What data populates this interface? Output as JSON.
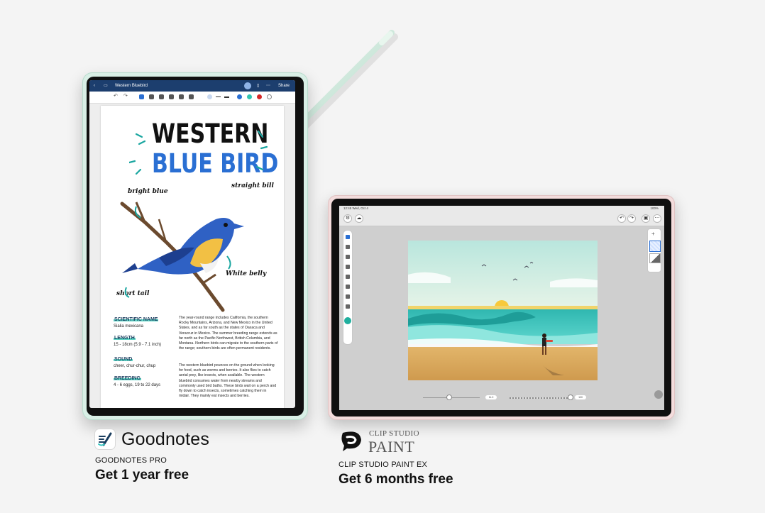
{
  "goodnotes": {
    "app_name": "Goodnotes",
    "product": "GOODNOTES PRO",
    "offer": "Get 1 year free",
    "document_title": "Western Bluebird",
    "share_label": "Share",
    "page": {
      "heading_line1": "WESTERN",
      "heading_line2": "BLUE BIRD",
      "annotations": {
        "bright_blue": "bright blue",
        "straight_bill": "straight bill",
        "white_belly": "White belly",
        "short_tail": "short tail"
      },
      "fields": [
        {
          "label": "SCIENTIFIC NAME",
          "value": "Sialia mexicana"
        },
        {
          "label": "LENGTH",
          "value": "15 - 18cm (5.9 - 7.1 inch)"
        },
        {
          "label": "SOUND",
          "value": "cheer, chur-chur, chup"
        },
        {
          "label": "BREEDING",
          "value": "4 - 6 eggs, 19 to 22 days"
        }
      ],
      "paragraph1": "The year-round range includes California, the southern Rocky Mountains, Arizona, and New Mexico in the United States, and as far south as the states of Oaxaca and Veracruz in Mexico. The summer breeding range extends as far north as the Pacific Northwest, British Columbia, and Montana. Northern birds can migrate to the southern parts of the range; southern birds are often permanent residents.",
      "paragraph2": "The western bluebird pounces on the ground when looking for food, such as worms and berries. It also flies to catch aerial prey, like insects, when available. The western bluebird consumes water from nearby streams and commonly used bird baths. These birds wait on a perch and fly down to catch insects, sometimes catching them in midair. They mainly eat insects and berries."
    },
    "colors": {
      "accent_blue": "#2a6fd3",
      "highlight_teal": "#5fd3c4",
      "topbar": "#1c3e6e"
    }
  },
  "clipstudio": {
    "brand_line1": "CLIP STUDIO",
    "brand_line2": "PAINT",
    "product": "CLIP STUDIO PAINT EX",
    "offer": "Get 6 months free",
    "status_time": "12:45  Wed, Oct 4",
    "status_battery": "100%",
    "slider_values": [
      "11.0",
      "100"
    ]
  }
}
